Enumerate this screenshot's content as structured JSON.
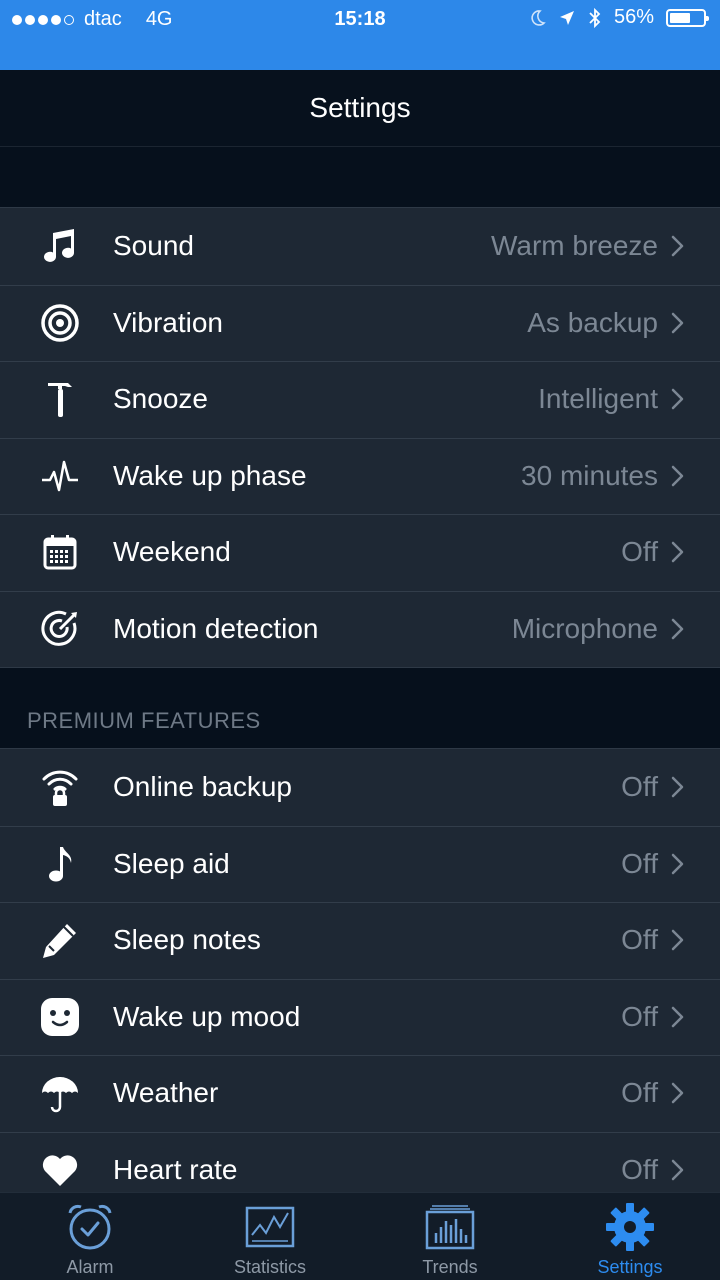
{
  "status_bar": {
    "carrier": "dtac",
    "network": "4G",
    "time": "15:18",
    "battery": "56%"
  },
  "nav": {
    "title": "Settings"
  },
  "settings": [
    {
      "icon": "music-notes-icon",
      "label": "Sound",
      "value": "Warm breeze"
    },
    {
      "icon": "target-icon",
      "label": "Vibration",
      "value": "As backup"
    },
    {
      "icon": "hammer-icon",
      "label": "Snooze",
      "value": "Intelligent"
    },
    {
      "icon": "pulse-icon",
      "label": "Wake up phase",
      "value": "30 minutes"
    },
    {
      "icon": "calendar-icon",
      "label": "Weekend",
      "value": "Off"
    },
    {
      "icon": "motion-radar-icon",
      "label": "Motion detection",
      "value": "Microphone"
    }
  ],
  "premium": {
    "header": "PREMIUM FEATURES",
    "items": [
      {
        "icon": "wifi-lock-icon",
        "label": "Online backup",
        "value": "Off"
      },
      {
        "icon": "music-note-icon",
        "label": "Sleep aid",
        "value": "Off"
      },
      {
        "icon": "pencil-icon",
        "label": "Sleep notes",
        "value": "Off"
      },
      {
        "icon": "smiley-icon",
        "label": "Wake up mood",
        "value": "Off"
      },
      {
        "icon": "umbrella-icon",
        "label": "Weather",
        "value": "Off"
      },
      {
        "icon": "heart-icon",
        "label": "Heart rate",
        "value": "Off"
      }
    ]
  },
  "tabs": [
    {
      "icon": "alarm-clock-icon",
      "label": "Alarm"
    },
    {
      "icon": "statistics-graph-icon",
      "label": "Statistics"
    },
    {
      "icon": "trends-bars-icon",
      "label": "Trends"
    },
    {
      "icon": "gear-icon",
      "label": "Settings",
      "active": true
    }
  ],
  "colors": {
    "accent": "#2d8cf0",
    "status_bar": "#2d88e9",
    "background": "#06101c",
    "row": "#1e2834"
  }
}
